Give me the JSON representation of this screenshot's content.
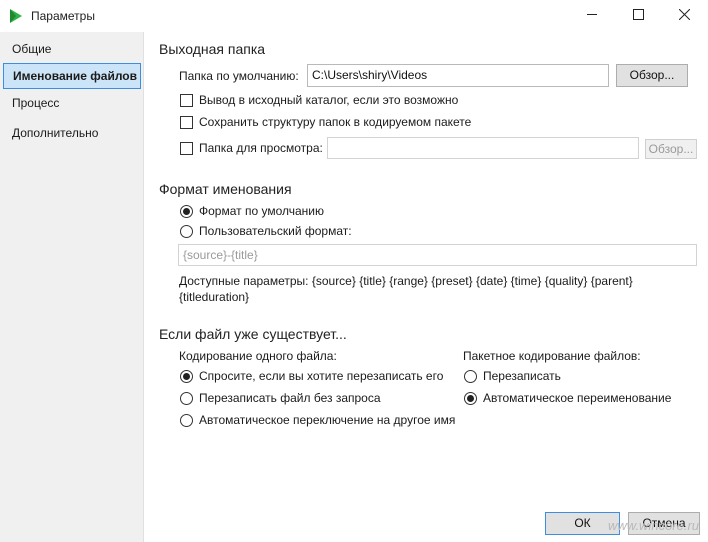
{
  "window": {
    "title": "Параметры"
  },
  "sidebar": {
    "items": [
      {
        "label": "Общие"
      },
      {
        "label": "Именование файлов"
      },
      {
        "label": "Процесс"
      },
      {
        "label": "Дополнительно"
      }
    ]
  },
  "output": {
    "title": "Выходная папка",
    "default_folder_label": "Папка по умолчанию:",
    "default_folder_value": "C:\\Users\\shiry\\Videos",
    "browse_label": "Обзор...",
    "source_dir_label": "Вывод в исходный каталог, если это возможно",
    "keep_structure_label": "Сохранить структуру папок в кодируемом пакете",
    "preview_folder_label": "Папка для просмотра:",
    "preview_browse_label": "Обзор..."
  },
  "naming": {
    "title": "Формат именования",
    "default_format_label": "Формат по умолчанию",
    "custom_format_label": "Пользовательский формат:",
    "custom_placeholder": "{source}-{title}",
    "params_line1": "Доступные параметры: {source} {title} {range} {preset} {date} {time} {quality} {parent}",
    "params_line2": "{titleduration}"
  },
  "exists": {
    "title": "Если файл уже существует...",
    "single_title": "Кодирование одного файла:",
    "single_options": [
      {
        "label": "Спросите, если вы хотите перезаписать его",
        "checked": true
      },
      {
        "label": "Перезаписать файл без запроса",
        "checked": false
      },
      {
        "label": "Автоматическое переключение на другое имя",
        "checked": false
      }
    ],
    "batch_title": "Пакетное кодирование файлов:",
    "batch_options": [
      {
        "label": "Перезаписать",
        "checked": false
      },
      {
        "label": "Автоматическое переименование",
        "checked": true
      }
    ]
  },
  "footer": {
    "ok_label": "ОК",
    "cancel_label": "Отмена",
    "watermark": "www.wincore.ru"
  },
  "colors": {
    "accent": "#3d8ee0",
    "selected_bg": "#cce4f7",
    "sidebar_bg": "#f0f0f0",
    "app_icon": "#2fb344"
  }
}
